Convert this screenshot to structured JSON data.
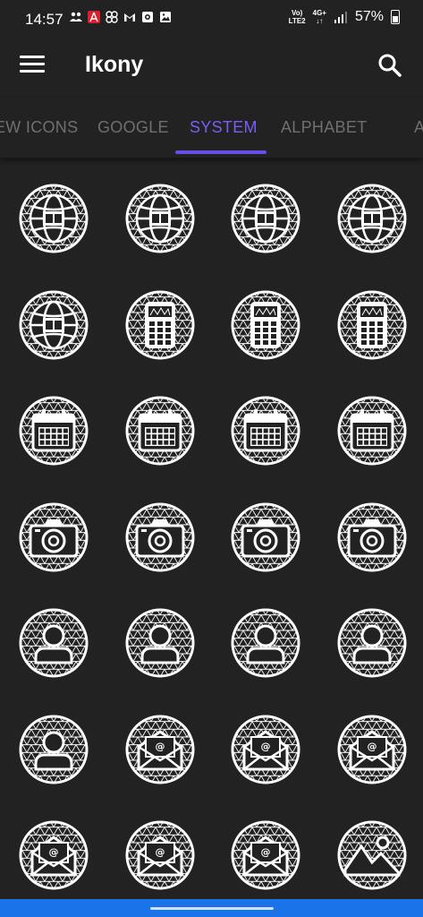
{
  "status": {
    "time": "14:57",
    "battery": "57%",
    "network_top": "Vo)",
    "network_bottom": "LTE2",
    "data_top": "4G+",
    "data_bottom": "↓↑",
    "icons": [
      "people-icon",
      "acrobat-icon",
      "pinwheel-icon",
      "gmail-icon",
      "camera-box-icon",
      "gallery-icon"
    ]
  },
  "appbar": {
    "title": "Ikony"
  },
  "tabs": [
    {
      "label": "EW ICONS",
      "active": false
    },
    {
      "label": "GOOGLE",
      "active": false
    },
    {
      "label": "SYSTEM",
      "active": true
    },
    {
      "label": "ALPHABET",
      "active": false
    },
    {
      "label": "A",
      "active": false
    }
  ],
  "icon_grid": [
    [
      "globe",
      "globe",
      "globe",
      "globe"
    ],
    [
      "globe",
      "calculator",
      "calculator",
      "calculator"
    ],
    [
      "calendar",
      "calendar",
      "calendar",
      "calendar"
    ],
    [
      "camera",
      "camera",
      "camera",
      "camera"
    ],
    [
      "contact",
      "contact",
      "contact",
      "contact"
    ],
    [
      "contact",
      "email",
      "email",
      "email"
    ],
    [
      "email",
      "email",
      "email",
      "gallery"
    ]
  ],
  "colors": {
    "background": "#222222",
    "accent": "#7d5df5",
    "tab_inactive": "#6f6f6f",
    "nav_bar": "#1a73e8"
  }
}
